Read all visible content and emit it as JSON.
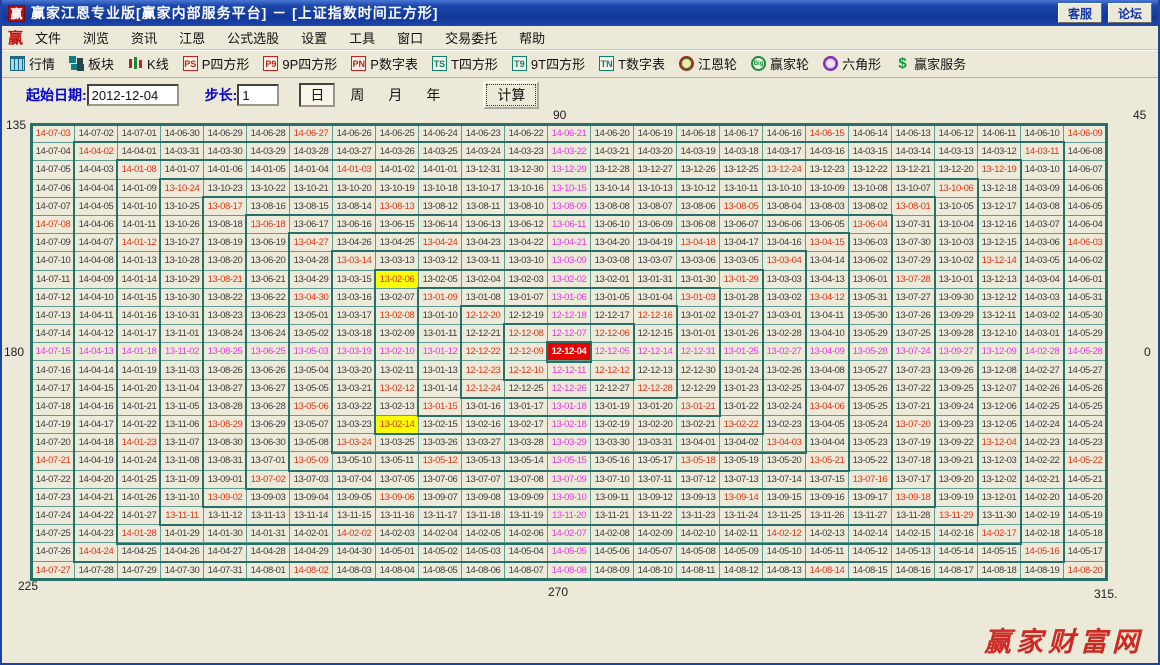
{
  "window": {
    "title": "赢家江恩专业版[赢家内部服务平台] － [上证指数时间正方形]",
    "logo_char": "赢",
    "buttons": [
      {
        "label": "客服"
      },
      {
        "label": "论坛"
      }
    ]
  },
  "menu": {
    "logo_char": "赢",
    "items": [
      "文件",
      "浏览",
      "资讯",
      "江恩",
      "公式选股",
      "设置",
      "工具",
      "窗口",
      "交易委托",
      "帮助"
    ]
  },
  "toolbar": {
    "items": [
      {
        "icon": "table-icon",
        "badge": "",
        "label": "行情"
      },
      {
        "icon": "blocks-icon",
        "badge": "",
        "label": "板块"
      },
      {
        "icon": "candlestick-icon",
        "badge": "",
        "label": "K线"
      },
      {
        "icon": "badge-red",
        "badge": "PS",
        "label": "P四方形"
      },
      {
        "icon": "badge-red",
        "badge": "P9",
        "label": "9P四方形"
      },
      {
        "icon": "badge-red",
        "badge": "PN",
        "label": "P数字表"
      },
      {
        "icon": "badge-teal",
        "badge": "TS",
        "label": "T四方形"
      },
      {
        "icon": "badge-teal",
        "badge": "T9",
        "label": "9T四方形"
      },
      {
        "icon": "badge-teal",
        "badge": "TN",
        "label": "T数字表"
      },
      {
        "icon": "gann-wheel-icon",
        "badge": "",
        "label": "江恩轮"
      },
      {
        "icon": "winner-wheel-icon",
        "badge": "Big",
        "label": "赢家轮"
      },
      {
        "icon": "hexagon-icon",
        "badge": "",
        "label": "六角形"
      },
      {
        "icon": "dollar-icon",
        "badge": "$",
        "label": "赢家服务"
      }
    ]
  },
  "controls": {
    "start_date_label": "起始日期:",
    "start_date_value": "2012-12-04",
    "step_label": "步长:",
    "step_value": "1",
    "period_options": [
      "日",
      "周",
      "月",
      "年"
    ],
    "period_selected": "日",
    "calc_label": "计算"
  },
  "gann": {
    "angle_labels": {
      "top_left": "135",
      "top": "90",
      "top_right": "45",
      "left": "180",
      "right": "0",
      "bottom_left": "225",
      "bottom": "270",
      "bottom_right": "315."
    },
    "colors": {
      "normal_text": "#3c3c3c",
      "red_text": "#e03414",
      "magenta_text": "#e23ae2",
      "center_bg": "#e80000",
      "highlight_bg": "#ffff00",
      "ring_line": "#27706a",
      "cell_line": "#5f9d94",
      "cell_bg": "#edead9"
    },
    "center_date": "12-12-04",
    "grid_dates": [
      [
        "14-07-03",
        "14-07-02",
        "14-07-01",
        "14-06-30",
        "14-06-29",
        "14-06-28",
        "14-06-27",
        "14-06-26",
        "14-06-25",
        "14-06-24",
        "14-06-23",
        "14-06-22",
        "14-06-21",
        "14-06-20",
        "14-06-19",
        "14-06-18",
        "14-06-17",
        "14-06-16",
        "14-06-15",
        "14-06-14",
        "14-06-13",
        "14-06-12",
        "14-06-11",
        "14-06-10",
        "14-06-09"
      ],
      [
        "14-07-04",
        "14-04-02",
        "14-04-01",
        "14-03-31",
        "14-03-30",
        "14-03-29",
        "14-03-28",
        "14-03-27",
        "14-03-26",
        "14-03-25",
        "14-03-24",
        "14-03-23",
        "14-03-22",
        "14-03-21",
        "14-03-20",
        "14-03-19",
        "14-03-18",
        "14-03-17",
        "14-03-16",
        "14-03-15",
        "14-03-14",
        "14-03-13",
        "14-03-12",
        "14-03-11",
        "14-06-08"
      ],
      [
        "14-07-05",
        "14-04-03",
        "14-01-08",
        "14-01-07",
        "14-01-06",
        "14-01-05",
        "14-01-04",
        "14-01-03",
        "14-01-02",
        "14-01-01",
        "13-12-31",
        "13-12-30",
        "13-12-29",
        "13-12-28",
        "13-12-27",
        "13-12-26",
        "13-12-25",
        "13-12-24",
        "13-12-23",
        "13-12-22",
        "13-12-21",
        "13-12-20",
        "13-12-19",
        "14-03-10",
        "14-06-07"
      ],
      [
        "14-07-06",
        "14-04-04",
        "14-01-09",
        "13-10-24",
        "13-10-23",
        "13-10-22",
        "13-10-21",
        "13-10-20",
        "13-10-19",
        "13-10-18",
        "13-10-17",
        "13-10-16",
        "13-10-15",
        "13-10-14",
        "13-10-13",
        "13-10-12",
        "13-10-11",
        "13-10-10",
        "13-10-09",
        "13-10-08",
        "13-10-07",
        "13-10-06",
        "13-12-18",
        "14-03-09",
        "14-06-06"
      ],
      [
        "14-07-07",
        "14-04-05",
        "14-01-10",
        "13-10-25",
        "13-08-17",
        "13-08-16",
        "13-08-15",
        "13-08-14",
        "13-08-13",
        "13-08-12",
        "13-08-11",
        "13-08-10",
        "13-08-09",
        "13-08-08",
        "13-08-07",
        "13-08-06",
        "13-08-05",
        "13-08-04",
        "13-08-03",
        "13-08-02",
        "13-08-01",
        "13-10-05",
        "13-12-17",
        "14-03-08",
        "14-06-05"
      ],
      [
        "14-07-08",
        "14-04-06",
        "14-01-11",
        "13-10-26",
        "13-08-18",
        "13-06-18",
        "13-06-17",
        "13-06-16",
        "13-06-15",
        "13-06-14",
        "13-06-13",
        "13-06-12",
        "13-06-11",
        "13-06-10",
        "13-06-09",
        "13-06-08",
        "13-06-07",
        "13-06-06",
        "13-06-05",
        "13-06-04",
        "13-07-31",
        "13-10-04",
        "13-12-16",
        "14-03-07",
        "14-06-04"
      ],
      [
        "14-07-09",
        "14-04-07",
        "14-01-12",
        "13-10-27",
        "13-08-19",
        "13-06-19",
        "13-04-27",
        "13-04-26",
        "13-04-25",
        "13-04-24",
        "13-04-23",
        "13-04-22",
        "13-04-21",
        "13-04-20",
        "13-04-19",
        "13-04-18",
        "13-04-17",
        "13-04-16",
        "13-04-15",
        "13-06-03",
        "13-07-30",
        "13-10-03",
        "13-12-15",
        "14-03-06",
        "14-06-03"
      ],
      [
        "14-07-10",
        "14-04-08",
        "14-01-13",
        "13-10-28",
        "13-08-20",
        "13-06-20",
        "13-04-28",
        "13-03-14",
        "13-03-13",
        "13-03-12",
        "13-03-11",
        "13-03-10",
        "13-03-09",
        "13-03-08",
        "13-03-07",
        "13-03-06",
        "13-03-05",
        "13-03-04",
        "13-04-14",
        "13-06-02",
        "13-07-29",
        "13-10-02",
        "13-12-14",
        "14-03-05",
        "14-06-02"
      ],
      [
        "14-07-11",
        "14-04-09",
        "14-01-14",
        "13-10-29",
        "13-08-21",
        "13-06-21",
        "13-04-29",
        "13-03-15",
        "13-02-06",
        "13-02-05",
        "13-02-04",
        "13-02-03",
        "13-02-02",
        "13-02-01",
        "13-01-31",
        "13-01-30",
        "13-01-29",
        "13-03-03",
        "13-04-13",
        "13-06-01",
        "13-07-28",
        "13-10-01",
        "13-12-13",
        "14-03-04",
        "14-06-01"
      ],
      [
        "14-07-12",
        "14-04-10",
        "14-01-15",
        "13-10-30",
        "13-08-22",
        "13-06-22",
        "13-04-30",
        "13-03-16",
        "13-02-07",
        "13-01-09",
        "13-01-08",
        "13-01-07",
        "13-01-06",
        "13-01-05",
        "13-01-04",
        "13-01-03",
        "13-01-28",
        "13-03-02",
        "13-04-12",
        "13-05-31",
        "13-07-27",
        "13-09-30",
        "13-12-12",
        "14-03-03",
        "14-05-31"
      ],
      [
        "14-07-13",
        "14-04-11",
        "14-01-16",
        "13-10-31",
        "13-08-23",
        "13-06-23",
        "13-05-01",
        "13-03-17",
        "13-02-08",
        "13-01-10",
        "12-12-20",
        "12-12-19",
        "12-12-18",
        "12-12-17",
        "12-12-16",
        "13-01-02",
        "13-01-27",
        "13-03-01",
        "13-04-11",
        "13-05-30",
        "13-07-26",
        "13-09-29",
        "13-12-11",
        "14-03-02",
        "14-05-30"
      ],
      [
        "14-07-14",
        "14-04-12",
        "14-01-17",
        "13-11-01",
        "13-08-24",
        "13-06-24",
        "13-05-02",
        "13-03-18",
        "13-02-09",
        "13-01-11",
        "12-12-21",
        "12-12-08",
        "12-12-07",
        "12-12-06",
        "12-12-15",
        "13-01-01",
        "13-01-26",
        "13-02-28",
        "13-04-10",
        "13-05-29",
        "13-07-25",
        "13-09-28",
        "13-12-10",
        "14-03-01",
        "14-05-29"
      ],
      [
        "14-07-15",
        "14-04-13",
        "14-01-18",
        "13-11-02",
        "13-08-25",
        "13-06-25",
        "13-05-03",
        "13-03-19",
        "13-02-10",
        "13-01-12",
        "12-12-22",
        "12-12-09",
        "12-12-04",
        "12-12-05",
        "12-12-14",
        "12-12-31",
        "13-01-25",
        "13-02-27",
        "13-04-09",
        "13-05-28",
        "13-07-24",
        "13-09-27",
        "13-12-09",
        "14-02-28",
        "14-05-28"
      ],
      [
        "14-07-16",
        "14-04-14",
        "14-01-19",
        "13-11-03",
        "13-08-26",
        "13-06-26",
        "13-05-04",
        "13-03-20",
        "13-02-11",
        "13-01-13",
        "12-12-23",
        "12-12-10",
        "12-12-11",
        "12-12-12",
        "12-12-13",
        "12-12-30",
        "13-01-24",
        "13-02-26",
        "13-04-08",
        "13-05-27",
        "13-07-23",
        "13-09-26",
        "13-12-08",
        "14-02-27",
        "14-05-27"
      ],
      [
        "14-07-17",
        "14-04-15",
        "14-01-20",
        "13-11-04",
        "13-08-27",
        "13-06-27",
        "13-05-05",
        "13-03-21",
        "13-02-12",
        "13-01-14",
        "12-12-24",
        "12-12-25",
        "12-12-26",
        "12-12-27",
        "12-12-28",
        "12-12-29",
        "13-01-23",
        "13-02-25",
        "13-04-07",
        "13-05-26",
        "13-07-22",
        "13-09-25",
        "13-12-07",
        "14-02-26",
        "14-05-26"
      ],
      [
        "14-07-18",
        "14-04-16",
        "14-01-21",
        "13-11-05",
        "13-08-28",
        "13-06-28",
        "13-05-06",
        "13-03-22",
        "13-02-13",
        "13-01-15",
        "13-01-16",
        "13-01-17",
        "13-01-18",
        "13-01-19",
        "13-01-20",
        "13-01-21",
        "13-01-22",
        "13-02-24",
        "13-04-06",
        "13-05-25",
        "13-07-21",
        "13-09-24",
        "13-12-06",
        "14-02-25",
        "14-05-25"
      ],
      [
        "14-07-19",
        "14-04-17",
        "14-01-22",
        "13-11-06",
        "13-08-29",
        "13-06-29",
        "13-05-07",
        "13-03-23",
        "13-02-14",
        "13-02-15",
        "13-02-16",
        "13-02-17",
        "13-02-18",
        "13-02-19",
        "13-02-20",
        "13-02-21",
        "13-02-22",
        "13-02-23",
        "13-04-05",
        "13-05-24",
        "13-07-20",
        "13-09-23",
        "13-12-05",
        "14-02-24",
        "14-05-24"
      ],
      [
        "14-07-20",
        "14-04-18",
        "14-01-23",
        "13-11-07",
        "13-08-30",
        "13-06-30",
        "13-05-08",
        "13-03-24",
        "13-03-25",
        "13-03-26",
        "13-03-27",
        "13-03-28",
        "13-03-29",
        "13-03-30",
        "13-03-31",
        "13-04-01",
        "13-04-02",
        "13-04-03",
        "13-04-04",
        "13-05-23",
        "13-07-19",
        "13-09-22",
        "13-12-04",
        "14-02-23",
        "14-05-23"
      ],
      [
        "14-07-21",
        "14-04-19",
        "14-01-24",
        "13-11-08",
        "13-08-31",
        "13-07-01",
        "13-05-09",
        "13-05-10",
        "13-05-11",
        "13-05-12",
        "13-05-13",
        "13-05-14",
        "13-05-15",
        "13-05-16",
        "13-05-17",
        "13-05-18",
        "13-05-19",
        "13-05-20",
        "13-05-21",
        "13-05-22",
        "13-07-18",
        "13-09-21",
        "13-12-03",
        "14-02-22",
        "14-05-22"
      ],
      [
        "14-07-22",
        "14-04-20",
        "14-01-25",
        "13-11-09",
        "13-09-01",
        "13-07-02",
        "13-07-03",
        "13-07-04",
        "13-07-05",
        "13-07-06",
        "13-07-07",
        "13-07-08",
        "13-07-09",
        "13-07-10",
        "13-07-11",
        "13-07-12",
        "13-07-13",
        "13-07-14",
        "13-07-15",
        "13-07-16",
        "13-07-17",
        "13-09-20",
        "13-12-02",
        "14-02-21",
        "14-05-21"
      ],
      [
        "14-07-23",
        "14-04-21",
        "14-01-26",
        "13-11-10",
        "13-09-02",
        "13-09-03",
        "13-09-04",
        "13-09-05",
        "13-09-06",
        "13-09-07",
        "13-09-08",
        "13-09-09",
        "13-09-10",
        "13-09-11",
        "13-09-12",
        "13-09-13",
        "13-09-14",
        "13-09-15",
        "13-09-16",
        "13-09-17",
        "13-09-18",
        "13-09-19",
        "13-12-01",
        "14-02-20",
        "14-05-20"
      ],
      [
        "14-07-24",
        "14-04-22",
        "14-01-27",
        "13-11-11",
        "13-11-12",
        "13-11-13",
        "13-11-14",
        "13-11-15",
        "13-11-16",
        "13-11-17",
        "13-11-18",
        "13-11-19",
        "13-11-20",
        "13-11-21",
        "13-11-22",
        "13-11-23",
        "13-11-24",
        "13-11-25",
        "13-11-26",
        "13-11-27",
        "13-11-28",
        "13-11-29",
        "13-11-30",
        "14-02-19",
        "14-05-19"
      ],
      [
        "14-07-25",
        "14-04-23",
        "14-01-28",
        "14-01-29",
        "14-01-30",
        "14-01-31",
        "14-02-01",
        "14-02-02",
        "14-02-03",
        "14-02-04",
        "14-02-05",
        "14-02-06",
        "14-02-07",
        "14-02-08",
        "14-02-09",
        "14-02-10",
        "14-02-11",
        "14-02-12",
        "14-02-13",
        "14-02-14",
        "14-02-15",
        "14-02-16",
        "14-02-17",
        "14-02-18",
        "14-05-18"
      ],
      [
        "14-07-26",
        "14-04-24",
        "14-04-25",
        "14-04-26",
        "14-04-27",
        "14-04-28",
        "14-04-29",
        "14-04-30",
        "14-05-01",
        "14-05-02",
        "14-05-03",
        "14-05-04",
        "14-05-05",
        "14-05-06",
        "14-05-07",
        "14-05-08",
        "14-05-09",
        "14-05-10",
        "14-05-11",
        "14-05-12",
        "14-05-13",
        "14-05-14",
        "14-05-15",
        "14-05-16",
        "14-05-17"
      ],
      [
        "14-07-27",
        "14-07-28",
        "14-07-29",
        "14-07-30",
        "14-07-31",
        "14-08-01",
        "14-08-02",
        "14-08-03",
        "14-08-04",
        "14-08-05",
        "14-08-06",
        "14-08-07",
        "14-08-08",
        "14-08-09",
        "14-08-10",
        "14-08-11",
        "14-08-12",
        "14-08-13",
        "14-08-14",
        "14-08-15",
        "14-08-16",
        "14-08-17",
        "14-08-18",
        "14-08-19",
        "14-08-20"
      ]
    ],
    "grid_styles": [
      "rnnnnnrnnnnnmnnnnnrnnnnnr",
      "nrnnnnnnnnnnmnnnnnnnnnnrn",
      "nnrnnnnrnnnnmnnnnrnnnnrnn",
      "nnnrnnnnnnnnmnnnnnnnnrnnn",
      "nnnnrnnnrnnnmnnnrnnnrnnnn",
      "rnnnnrnnnnnnmnnnnnnrnnnnn",
      "nnrnnnrnnrnnmnnrnnrnnnnnr",
      "nnnnnnnrnnnnmnnnnrnnnnrnn",
      "nnnnrnnnynnnmnnnrnnnrnnnn",
      "nnnnnnrnnrnnmnnrnnrnnnnnn",
      "nnnnnnnnrnrnmnrnnnnnnnnnn",
      "nnnnnnnnnnnrmrnnnnnnnnnnn",
      "mmmmmmmmmmrrcmmmmmmmmmmmm",
      "nnnnnnnnnnrrmrnnnnnnnnnnn",
      "nnnnnnnnrnrnmnrnnnnnnnnnn",
      "nnnnnnrnnrnnmnnrnnrnnnnnn",
      "nnnnrnnnynnnmnnnrnnnrnnnn",
      "nnrnnnnrnnnnmnnnnrnnnnrnn",
      "rnnnnnrnnrnnmnnrnnrnnnnnr",
      "nnnnnrnnnnnnmnnnnnnrnnnnn",
      "nnnnrnnnrnnnmnnnrnnnrnnnn",
      "nnnrnnnnnnnnmnnnnnnnnrnnn",
      "nnrnnnnrnnnnmnnnnrnnnnrnn",
      "nrnnnnnnnnnnmnnnnnnnnnnrn",
      "rnnnnnrnnnnnmnnnnnrnnnnnr"
    ]
  },
  "watermark": "赢家财富网"
}
